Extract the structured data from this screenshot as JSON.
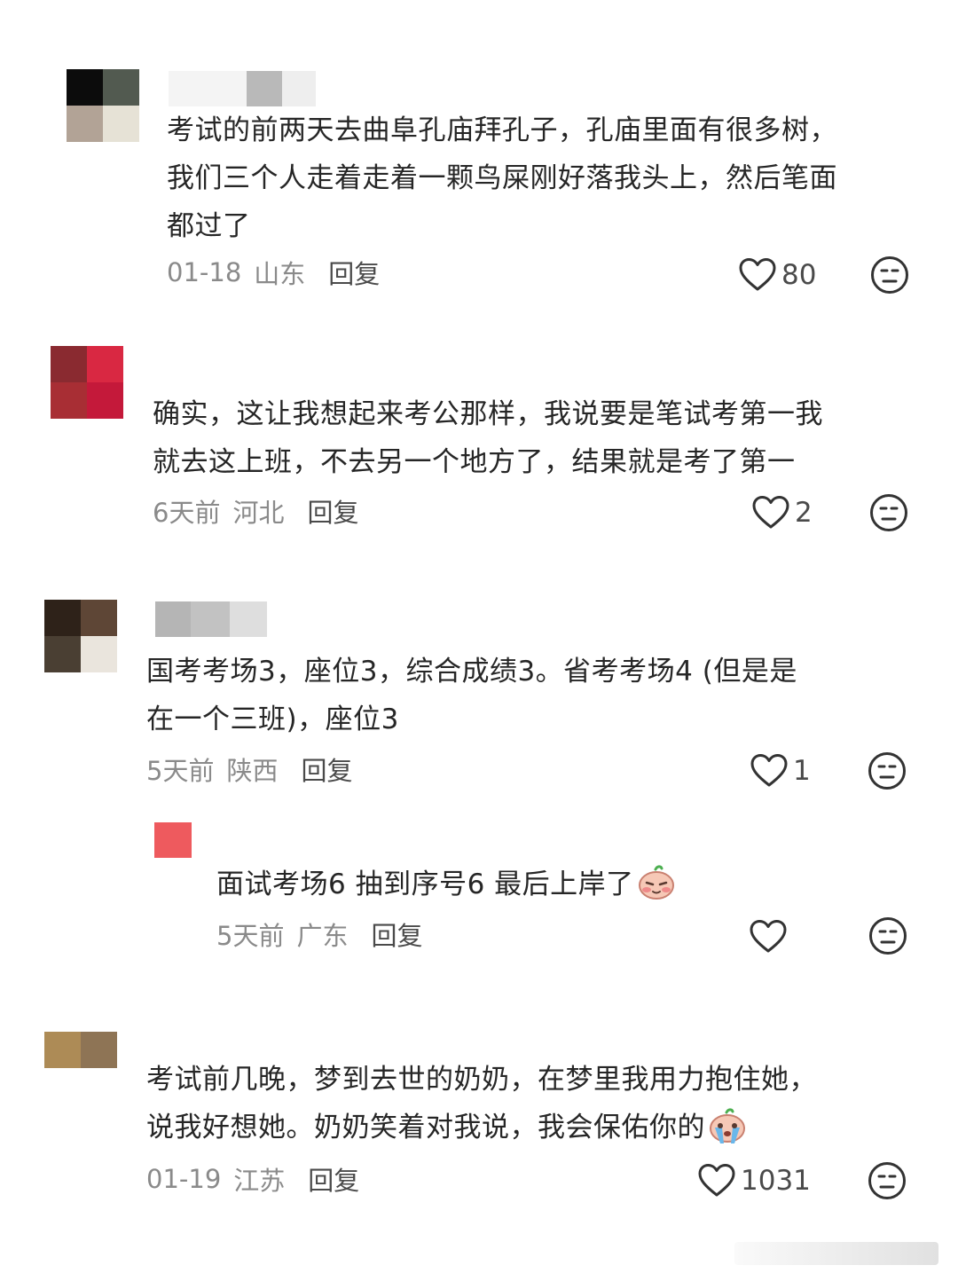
{
  "comments": [
    {
      "text_lines": [
        "考试的前两天去曲阜孔庙拜孔子，孔庙里面有很多树，",
        "我们三个人走着走着一颗鸟屎刚好落我头上，然后笔面",
        "都过了"
      ],
      "date": "01-18",
      "region": "山东",
      "reply_label": "回复",
      "likes": "80"
    },
    {
      "text_lines": [
        "确实，这让我想起来考公那样，我说要是笔试考第一我",
        "就去这上班，不去另一个地方了，结果就是考了第一"
      ],
      "date": "6天前",
      "region": "河北",
      "reply_label": "回复",
      "likes": "2"
    },
    {
      "text_lines": [
        "国考考场3，座位3，综合成绩3。省考考场4 (但是是",
        "在一个三班)，座位3"
      ],
      "date": "5天前",
      "region": "陕西",
      "reply_label": "回复",
      "likes": "1",
      "reply": {
        "text": "面试考场6 抽到序号6 最后上岸了",
        "date": "5天前",
        "region": "广东",
        "reply_label": "回复",
        "likes": ""
      }
    },
    {
      "text_lines": [
        "考试前几晚，梦到去世的奶奶，在梦里我用力抱住她，",
        "说我好想她。奶奶笑着对我说，我会保佑你的"
      ],
      "date": "01-19",
      "region": "江苏",
      "reply_label": "回复",
      "likes": "1031"
    }
  ],
  "icons": {
    "like": "heart-outline-icon",
    "dislike": "neutral-face-icon",
    "emoji_1": "blushing-emoji",
    "emoji_2": "crying-emoji"
  },
  "colors": {
    "text": "#262626",
    "meta": "#8a8a8a",
    "reply": "#4a4a4a",
    "icon": "#333333"
  }
}
